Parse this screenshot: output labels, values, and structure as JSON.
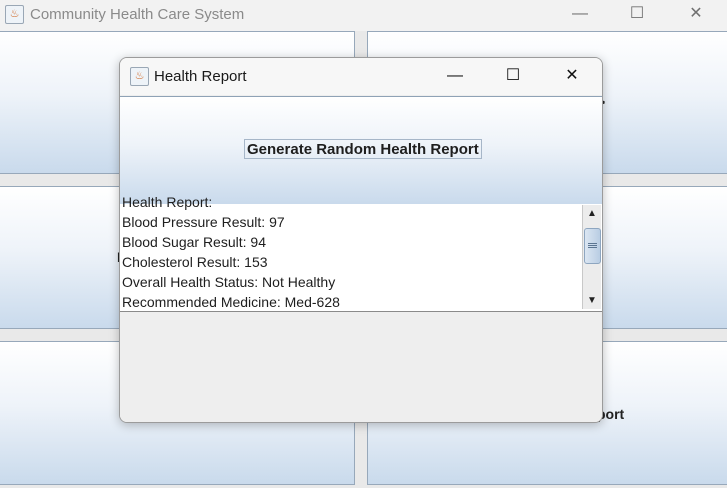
{
  "main_window": {
    "title": "Community Health Care System",
    "controls": {
      "minimize": "—",
      "maximize": "☐",
      "close": "✕"
    },
    "visible_fragments": {
      "left_middle_tile": "I",
      "right_top_tile": ">",
      "right_bottom_tile": "port"
    }
  },
  "dialog": {
    "title": "Health Report",
    "controls": {
      "minimize": "—",
      "maximize": "☐",
      "close": "✕"
    },
    "generate_button_label": "Generate Random Health Report",
    "report_lines": [
      "Health Report:",
      "Blood Pressure Result: 97",
      "Blood Sugar Result: 94",
      "Cholesterol Result: 153",
      "Overall Health Status: Not Healthy",
      "Recommended Medicine: Med-628"
    ],
    "scrollbar": {
      "up_arrow": "▲",
      "down_arrow": "▼"
    }
  }
}
